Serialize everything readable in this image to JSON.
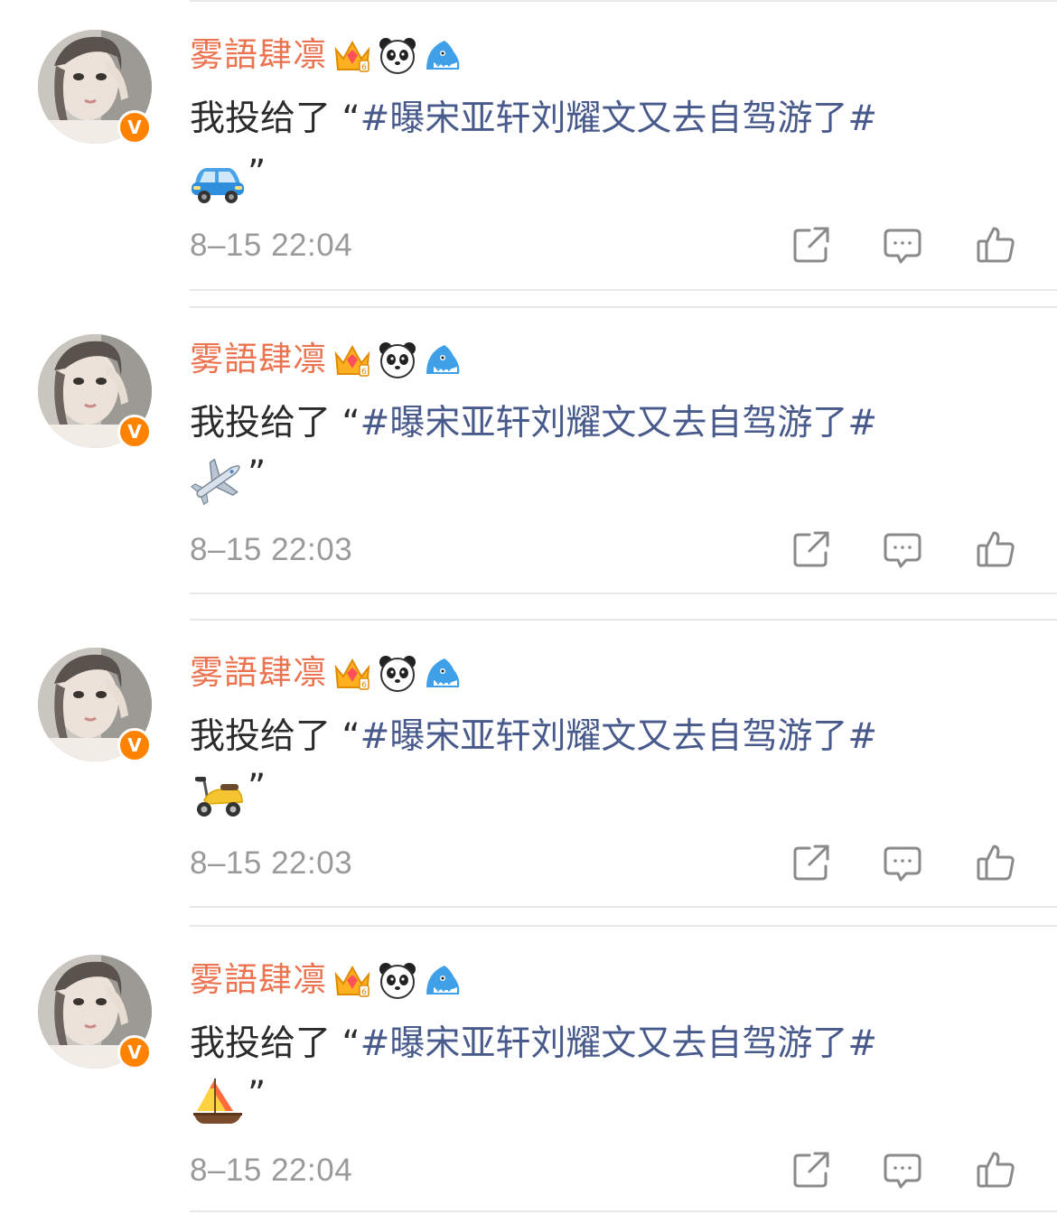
{
  "posts": [
    {
      "username": "雾語肆凛",
      "verified_mark": "V",
      "content_prefix": "我投给了",
      "open_quote": "“",
      "topic": "#曝宋亚轩刘耀文又去自驾游了#",
      "emoji": "car-emoji",
      "close_quote": "”",
      "time": "8–15 22:04"
    },
    {
      "username": "雾語肆凛",
      "verified_mark": "V",
      "content_prefix": "我投给了",
      "open_quote": "“",
      "topic": "#曝宋亚轩刘耀文又去自驾游了#",
      "emoji": "airplane-emoji",
      "close_quote": "”",
      "time": "8–15 22:03"
    },
    {
      "username": "雾語肆凛",
      "verified_mark": "V",
      "content_prefix": "我投给了",
      "open_quote": "“",
      "topic": "#曝宋亚轩刘耀文又去自驾游了#",
      "emoji": "scooter-emoji",
      "close_quote": "”",
      "time": "8–15 22:03"
    },
    {
      "username": "雾語肆凛",
      "verified_mark": "V",
      "content_prefix": "我投给了",
      "open_quote": "“",
      "topic": "#曝宋亚轩刘耀文又去自驾游了#",
      "emoji": "sailboat-emoji",
      "close_quote": "”",
      "time": "8–15 22:04"
    }
  ],
  "badges": [
    "crown-badge-icon",
    "panda-badge-icon",
    "shark-badge-icon"
  ],
  "actions": [
    "share-icon",
    "comment-icon",
    "like-icon"
  ],
  "colors": {
    "username": "#eb7350",
    "topic": "#485a8c",
    "text": "#2b2b2b",
    "time": "#9a9a9a",
    "verified": "#ff8200",
    "divider": "#e8e8e8"
  }
}
